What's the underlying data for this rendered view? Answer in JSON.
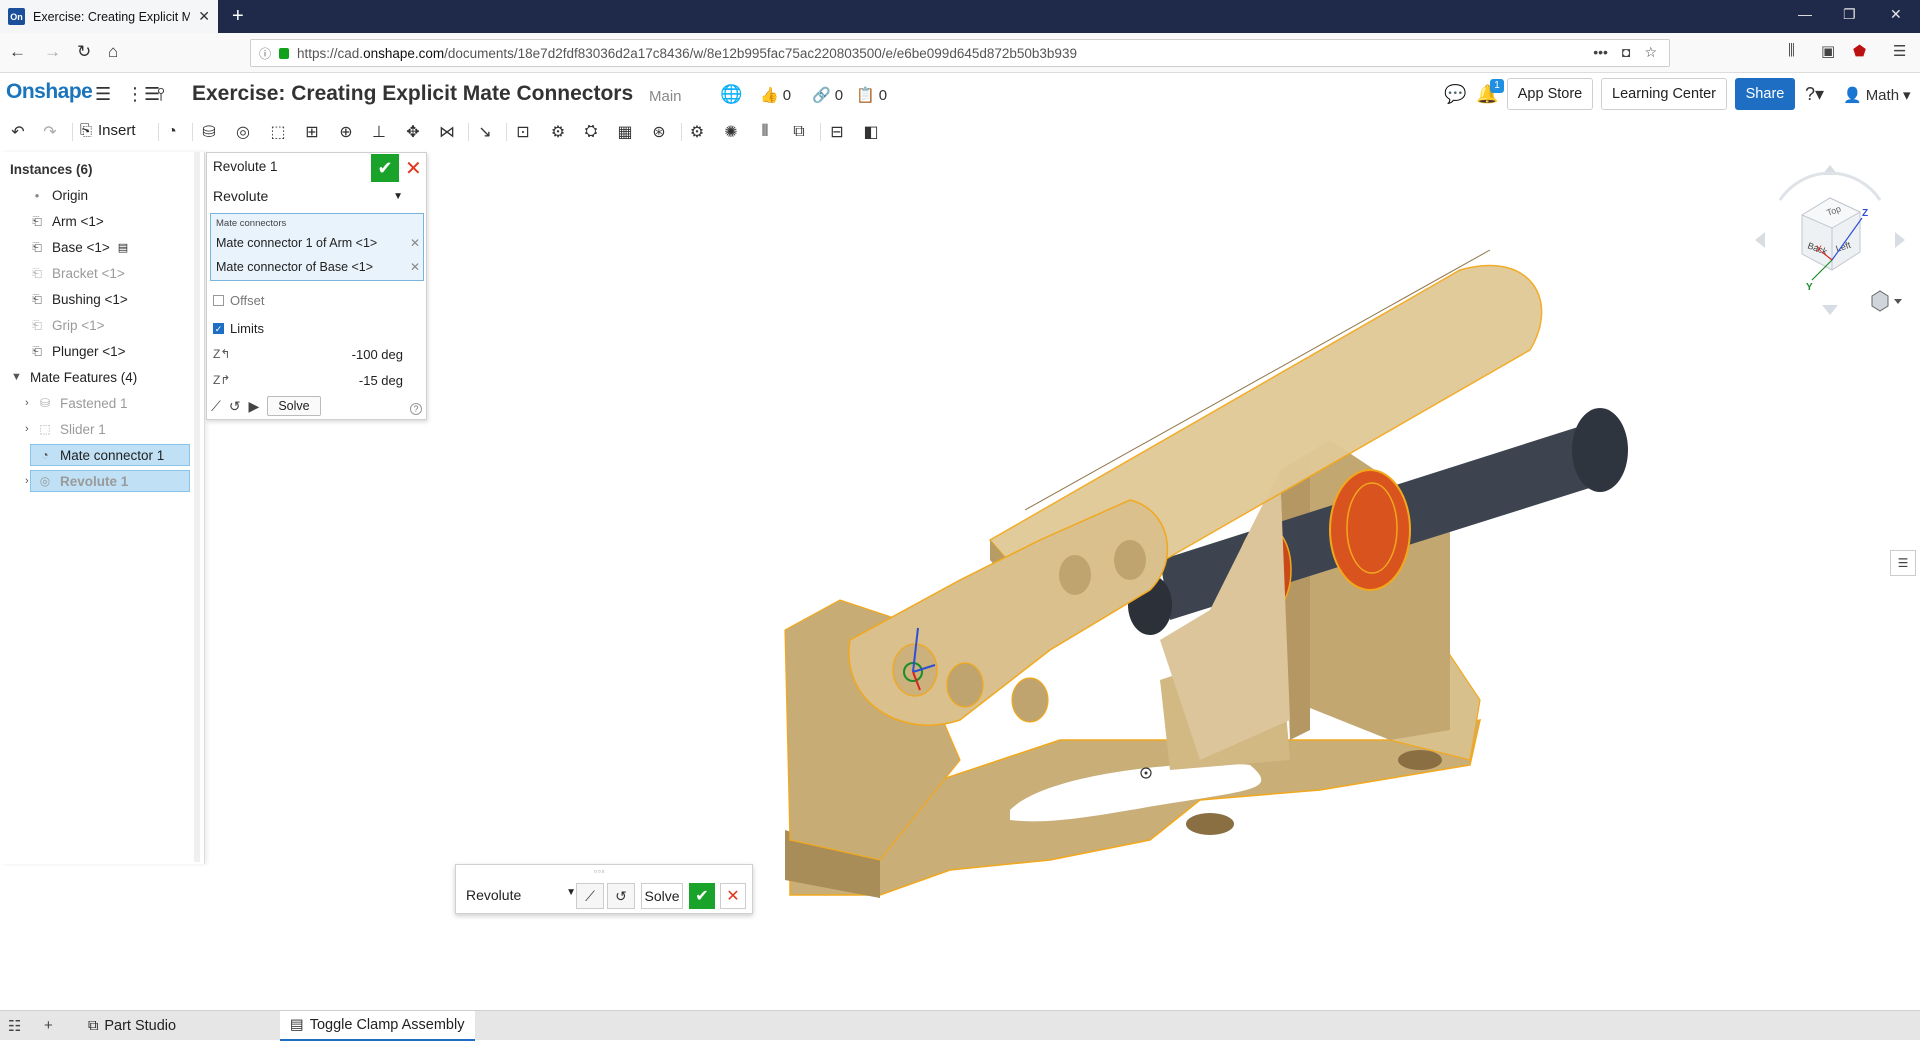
{
  "browser": {
    "tab_title": "Exercise: Creating Explicit Mate",
    "tab_favicon": "On",
    "url_prefix": "https://cad.",
    "url_domain": "onshape.com",
    "url_rest": "/documents/18e7d2fdf83036d2a17c8436/w/8e12b995fac75ac220803500/e/e6be099d645d872b50b3b939",
    "url_more": "•••"
  },
  "header": {
    "logo": "Onshape",
    "document_title": "Exercise: Creating Explicit Mate Connectors",
    "branch": "Main",
    "likes": "0",
    "links": "0",
    "copies": "0",
    "notification_count": "1",
    "app_store": "App Store",
    "learning_center": "Learning Center",
    "share": "Share",
    "user": "Math"
  },
  "toolbar": {
    "insert": "Insert"
  },
  "instances": {
    "heading": "Instances (6)",
    "items": [
      {
        "label": "Origin",
        "icon": "dot-icon",
        "dim": false
      },
      {
        "label": "Arm <1>",
        "icon": "part-icon",
        "dim": false
      },
      {
        "label": "Base <1>",
        "icon": "part-icon",
        "dim": false
      },
      {
        "label": "Bracket <1>",
        "icon": "part-icon",
        "dim": true
      },
      {
        "label": "Bushing <1>",
        "icon": "part-icon",
        "dim": false
      },
      {
        "label": "Grip <1>",
        "icon": "part-icon",
        "dim": true
      },
      {
        "label": "Plunger <1>",
        "icon": "part-icon",
        "dim": false
      }
    ],
    "mate_heading": "Mate Features (4)",
    "mates": [
      {
        "label": "Fastened 1",
        "dim": true
      },
      {
        "label": "Slider 1",
        "dim": true
      },
      {
        "label": "Mate connector 1",
        "dim": false
      },
      {
        "label": "Revolute 1",
        "dim": true
      }
    ]
  },
  "dialog": {
    "title": "Revolute 1",
    "type": "Revolute",
    "mate_connectors_label": "Mate connectors",
    "connectors": [
      "Mate connector 1 of Arm <1>",
      "Mate connector of Base <1>"
    ],
    "offset_label": "Offset",
    "offset_checked": false,
    "limits_label": "Limits",
    "limits_checked": true,
    "limit_min": "-100 deg",
    "limit_max": "-15 deg",
    "solve": "Solve",
    "help": "?"
  },
  "minibar": {
    "type": "Revolute",
    "solve": "Solve"
  },
  "viewcube": {
    "top": "Top",
    "back": "Back",
    "left": "Left",
    "axis_x": "X",
    "axis_y": "Y",
    "axis_z": "Z"
  },
  "bottom_tabs": {
    "part_studio": "Part Studio",
    "assembly": "Toggle Clamp Assembly"
  },
  "colors": {
    "accent": "#1e6fc4",
    "ok": "#1aa32b",
    "cancel": "#e2361b",
    "part_tan": "#d8c08c",
    "selection_outline": "#f2a81d",
    "bushing_orange": "#d9531e",
    "plunger_gray": "#3d4450"
  }
}
